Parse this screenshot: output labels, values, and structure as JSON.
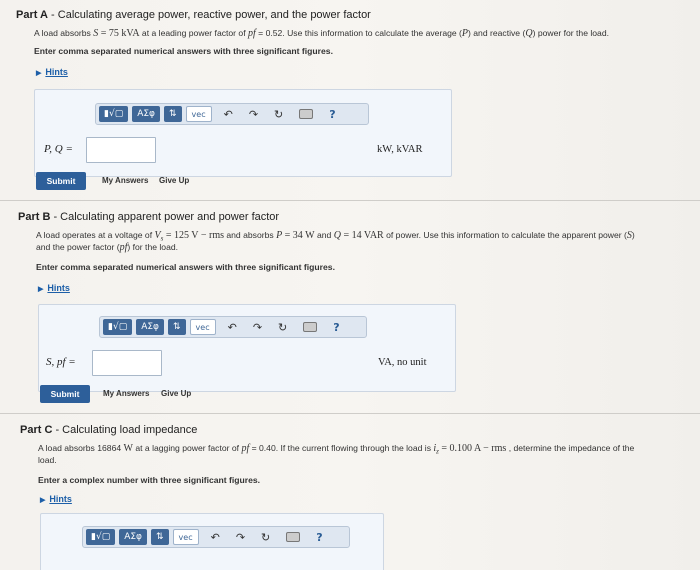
{
  "partA": {
    "title_bold": "Part A",
    "title_rest": " - Calculating average power, reactive power, and the power factor",
    "line1_a": "A load absorbs ",
    "line1_S": "S",
    "line1_eq": " = 75 kVA",
    "line1_b": " at a leading power factor of ",
    "line1_pf": "pf",
    "line1_c": " = 0.52. Use this information to calculate the average (",
    "line1_P": "P",
    "line1_d": ") and reactive (",
    "line1_Q": "Q",
    "line1_e": ") power for the load.",
    "instruction": "Enter comma separated numerical answers with three significant figures.",
    "hints": "Hints",
    "var_label": "P, Q =",
    "units": "kW, kVAR",
    "submit": "Submit",
    "my_answers": "My Answers",
    "give_up": "Give Up"
  },
  "partB": {
    "title_bold": "Part B",
    "title_rest": " - Calculating apparent power and power factor",
    "line1_a": "A load operates at a voltage of ",
    "line1_V": "V",
    "line1_sub": "s",
    "line1_eq": " = 125 V",
    "line1_rms": " − rms",
    "line1_b": " and absorbs ",
    "line1_P": "P",
    "line1_peq": " = 34 W",
    "line1_c": " and ",
    "line1_Q": "Q",
    "line1_qeq": " = 14 VAR",
    "line1_d": " of power. Use this information to calculate the apparent power (",
    "line1_S": "S",
    "line1_e": ")",
    "line2_a": "and the power factor (",
    "line2_pf": "pf",
    "line2_b": ") for the load.",
    "instruction": "Enter comma separated numerical answers with three significant figures.",
    "hints": "Hints",
    "var_label": "S, pf =",
    "units": "VA, no unit",
    "submit": "Submit",
    "my_answers": "My Answers",
    "give_up": "Give Up"
  },
  "partC": {
    "title_bold": "Part C",
    "title_rest": " - Calculating load impedance",
    "line1_a": "A load absorbs 16864 ",
    "line1_W": "W",
    "line1_b": "  at a lagging power factor of ",
    "line1_pf": "pf",
    "line1_c": " = 0.40. If the current flowing through the load is ",
    "line1_i": "i",
    "line1_isub": "z",
    "line1_ieq": " = 0.100 A",
    "line1_rms": " − rms",
    "line1_d": " , determine the impedance of the",
    "line2": "load.",
    "instruction": "Enter a complex number with three significant figures.",
    "hints": "Hints"
  },
  "toolbar": {
    "templates": "▮√▢",
    "greek": "ΑΣφ",
    "arrows": "⇅",
    "vec": "vec",
    "undo": "↶",
    "redo": "↷",
    "reset": "↻",
    "keyboard": "keyboard-icon",
    "help": "?"
  }
}
